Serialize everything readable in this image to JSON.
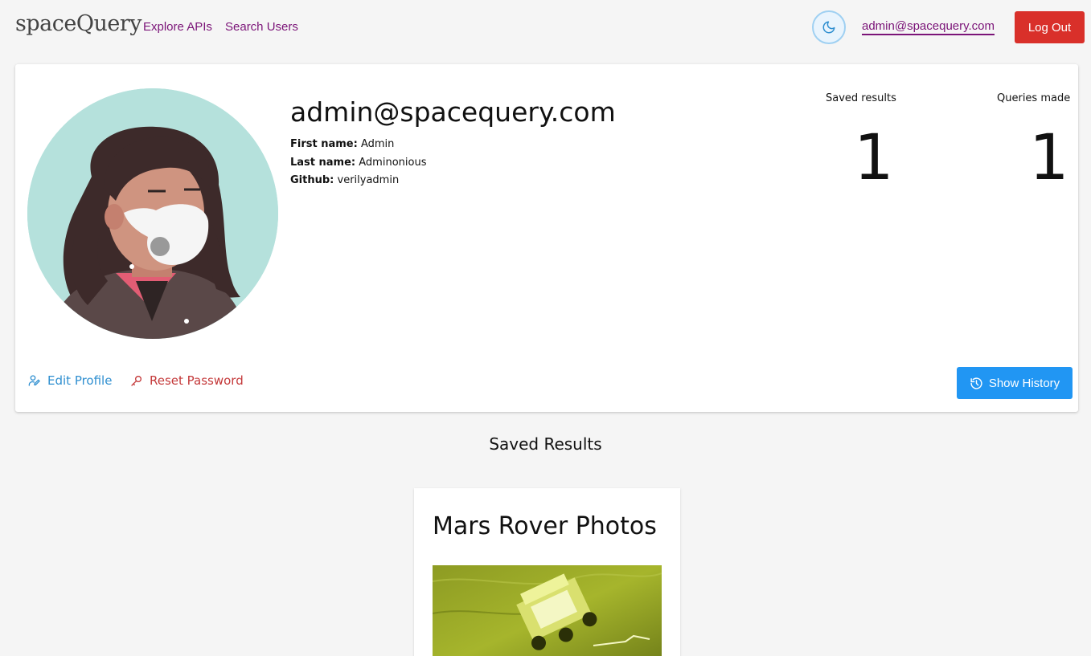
{
  "header": {
    "brand": "spaceQuery",
    "nav": [
      {
        "label": "Explore APIs"
      },
      {
        "label": "Search Users"
      }
    ],
    "theme_icon": "moon-icon",
    "user_email": "admin@spacequery.com",
    "logout_label": "Log Out"
  },
  "profile": {
    "email": "admin@spacequery.com",
    "first_name_label": "First name:",
    "first_name": "Admin",
    "last_name_label": "Last name:",
    "last_name": "Adminonious",
    "github_label": "Github:",
    "github": "verilyadmin",
    "stats": {
      "saved_label": "Saved results",
      "saved_value": "1",
      "queries_label": "Queries made",
      "queries_value": "1"
    },
    "edit_label": "Edit Profile",
    "reset_label": "Reset Password",
    "history_label": "Show History"
  },
  "saved_results": {
    "title": "Saved Results",
    "items": [
      {
        "title": "Mars Rover Photos"
      }
    ]
  },
  "colors": {
    "link_purple": "#7b1478",
    "logout_red": "#d9302a",
    "history_blue": "#2196f3",
    "edit_blue": "#2f8fd0",
    "reset_red": "#c4393a",
    "avatar_bg": "#b5e1dc"
  }
}
